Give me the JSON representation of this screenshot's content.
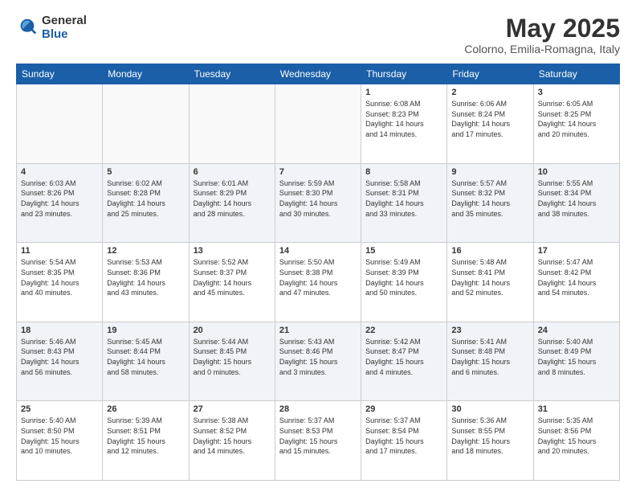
{
  "header": {
    "logo_general": "General",
    "logo_blue": "Blue",
    "main_title": "May 2025",
    "subtitle": "Colorno, Emilia-Romagna, Italy"
  },
  "calendar": {
    "days_of_week": [
      "Sunday",
      "Monday",
      "Tuesday",
      "Wednesday",
      "Thursday",
      "Friday",
      "Saturday"
    ],
    "weeks": [
      [
        {
          "day": "",
          "info": "",
          "empty": true
        },
        {
          "day": "",
          "info": "",
          "empty": true
        },
        {
          "day": "",
          "info": "",
          "empty": true
        },
        {
          "day": "",
          "info": "",
          "empty": true
        },
        {
          "day": "1",
          "info": "Sunrise: 6:08 AM\nSunset: 8:23 PM\nDaylight: 14 hours\nand 14 minutes."
        },
        {
          "day": "2",
          "info": "Sunrise: 6:06 AM\nSunset: 8:24 PM\nDaylight: 14 hours\nand 17 minutes."
        },
        {
          "day": "3",
          "info": "Sunrise: 6:05 AM\nSunset: 8:25 PM\nDaylight: 14 hours\nand 20 minutes."
        }
      ],
      [
        {
          "day": "4",
          "info": "Sunrise: 6:03 AM\nSunset: 8:26 PM\nDaylight: 14 hours\nand 23 minutes."
        },
        {
          "day": "5",
          "info": "Sunrise: 6:02 AM\nSunset: 8:28 PM\nDaylight: 14 hours\nand 25 minutes."
        },
        {
          "day": "6",
          "info": "Sunrise: 6:01 AM\nSunset: 8:29 PM\nDaylight: 14 hours\nand 28 minutes."
        },
        {
          "day": "7",
          "info": "Sunrise: 5:59 AM\nSunset: 8:30 PM\nDaylight: 14 hours\nand 30 minutes."
        },
        {
          "day": "8",
          "info": "Sunrise: 5:58 AM\nSunset: 8:31 PM\nDaylight: 14 hours\nand 33 minutes."
        },
        {
          "day": "9",
          "info": "Sunrise: 5:57 AM\nSunset: 8:32 PM\nDaylight: 14 hours\nand 35 minutes."
        },
        {
          "day": "10",
          "info": "Sunrise: 5:55 AM\nSunset: 8:34 PM\nDaylight: 14 hours\nand 38 minutes."
        }
      ],
      [
        {
          "day": "11",
          "info": "Sunrise: 5:54 AM\nSunset: 8:35 PM\nDaylight: 14 hours\nand 40 minutes."
        },
        {
          "day": "12",
          "info": "Sunrise: 5:53 AM\nSunset: 8:36 PM\nDaylight: 14 hours\nand 43 minutes."
        },
        {
          "day": "13",
          "info": "Sunrise: 5:52 AM\nSunset: 8:37 PM\nDaylight: 14 hours\nand 45 minutes."
        },
        {
          "day": "14",
          "info": "Sunrise: 5:50 AM\nSunset: 8:38 PM\nDaylight: 14 hours\nand 47 minutes."
        },
        {
          "day": "15",
          "info": "Sunrise: 5:49 AM\nSunset: 8:39 PM\nDaylight: 14 hours\nand 50 minutes."
        },
        {
          "day": "16",
          "info": "Sunrise: 5:48 AM\nSunset: 8:41 PM\nDaylight: 14 hours\nand 52 minutes."
        },
        {
          "day": "17",
          "info": "Sunrise: 5:47 AM\nSunset: 8:42 PM\nDaylight: 14 hours\nand 54 minutes."
        }
      ],
      [
        {
          "day": "18",
          "info": "Sunrise: 5:46 AM\nSunset: 8:43 PM\nDaylight: 14 hours\nand 56 minutes."
        },
        {
          "day": "19",
          "info": "Sunrise: 5:45 AM\nSunset: 8:44 PM\nDaylight: 14 hours\nand 58 minutes."
        },
        {
          "day": "20",
          "info": "Sunrise: 5:44 AM\nSunset: 8:45 PM\nDaylight: 15 hours\nand 0 minutes."
        },
        {
          "day": "21",
          "info": "Sunrise: 5:43 AM\nSunset: 8:46 PM\nDaylight: 15 hours\nand 3 minutes."
        },
        {
          "day": "22",
          "info": "Sunrise: 5:42 AM\nSunset: 8:47 PM\nDaylight: 15 hours\nand 4 minutes."
        },
        {
          "day": "23",
          "info": "Sunrise: 5:41 AM\nSunset: 8:48 PM\nDaylight: 15 hours\nand 6 minutes."
        },
        {
          "day": "24",
          "info": "Sunrise: 5:40 AM\nSunset: 8:49 PM\nDaylight: 15 hours\nand 8 minutes."
        }
      ],
      [
        {
          "day": "25",
          "info": "Sunrise: 5:40 AM\nSunset: 8:50 PM\nDaylight: 15 hours\nand 10 minutes."
        },
        {
          "day": "26",
          "info": "Sunrise: 5:39 AM\nSunset: 8:51 PM\nDaylight: 15 hours\nand 12 minutes."
        },
        {
          "day": "27",
          "info": "Sunrise: 5:38 AM\nSunset: 8:52 PM\nDaylight: 15 hours\nand 14 minutes."
        },
        {
          "day": "28",
          "info": "Sunrise: 5:37 AM\nSunset: 8:53 PM\nDaylight: 15 hours\nand 15 minutes."
        },
        {
          "day": "29",
          "info": "Sunrise: 5:37 AM\nSunset: 8:54 PM\nDaylight: 15 hours\nand 17 minutes."
        },
        {
          "day": "30",
          "info": "Sunrise: 5:36 AM\nSunset: 8:55 PM\nDaylight: 15 hours\nand 18 minutes."
        },
        {
          "day": "31",
          "info": "Sunrise: 5:35 AM\nSunset: 8:56 PM\nDaylight: 15 hours\nand 20 minutes."
        }
      ]
    ]
  }
}
